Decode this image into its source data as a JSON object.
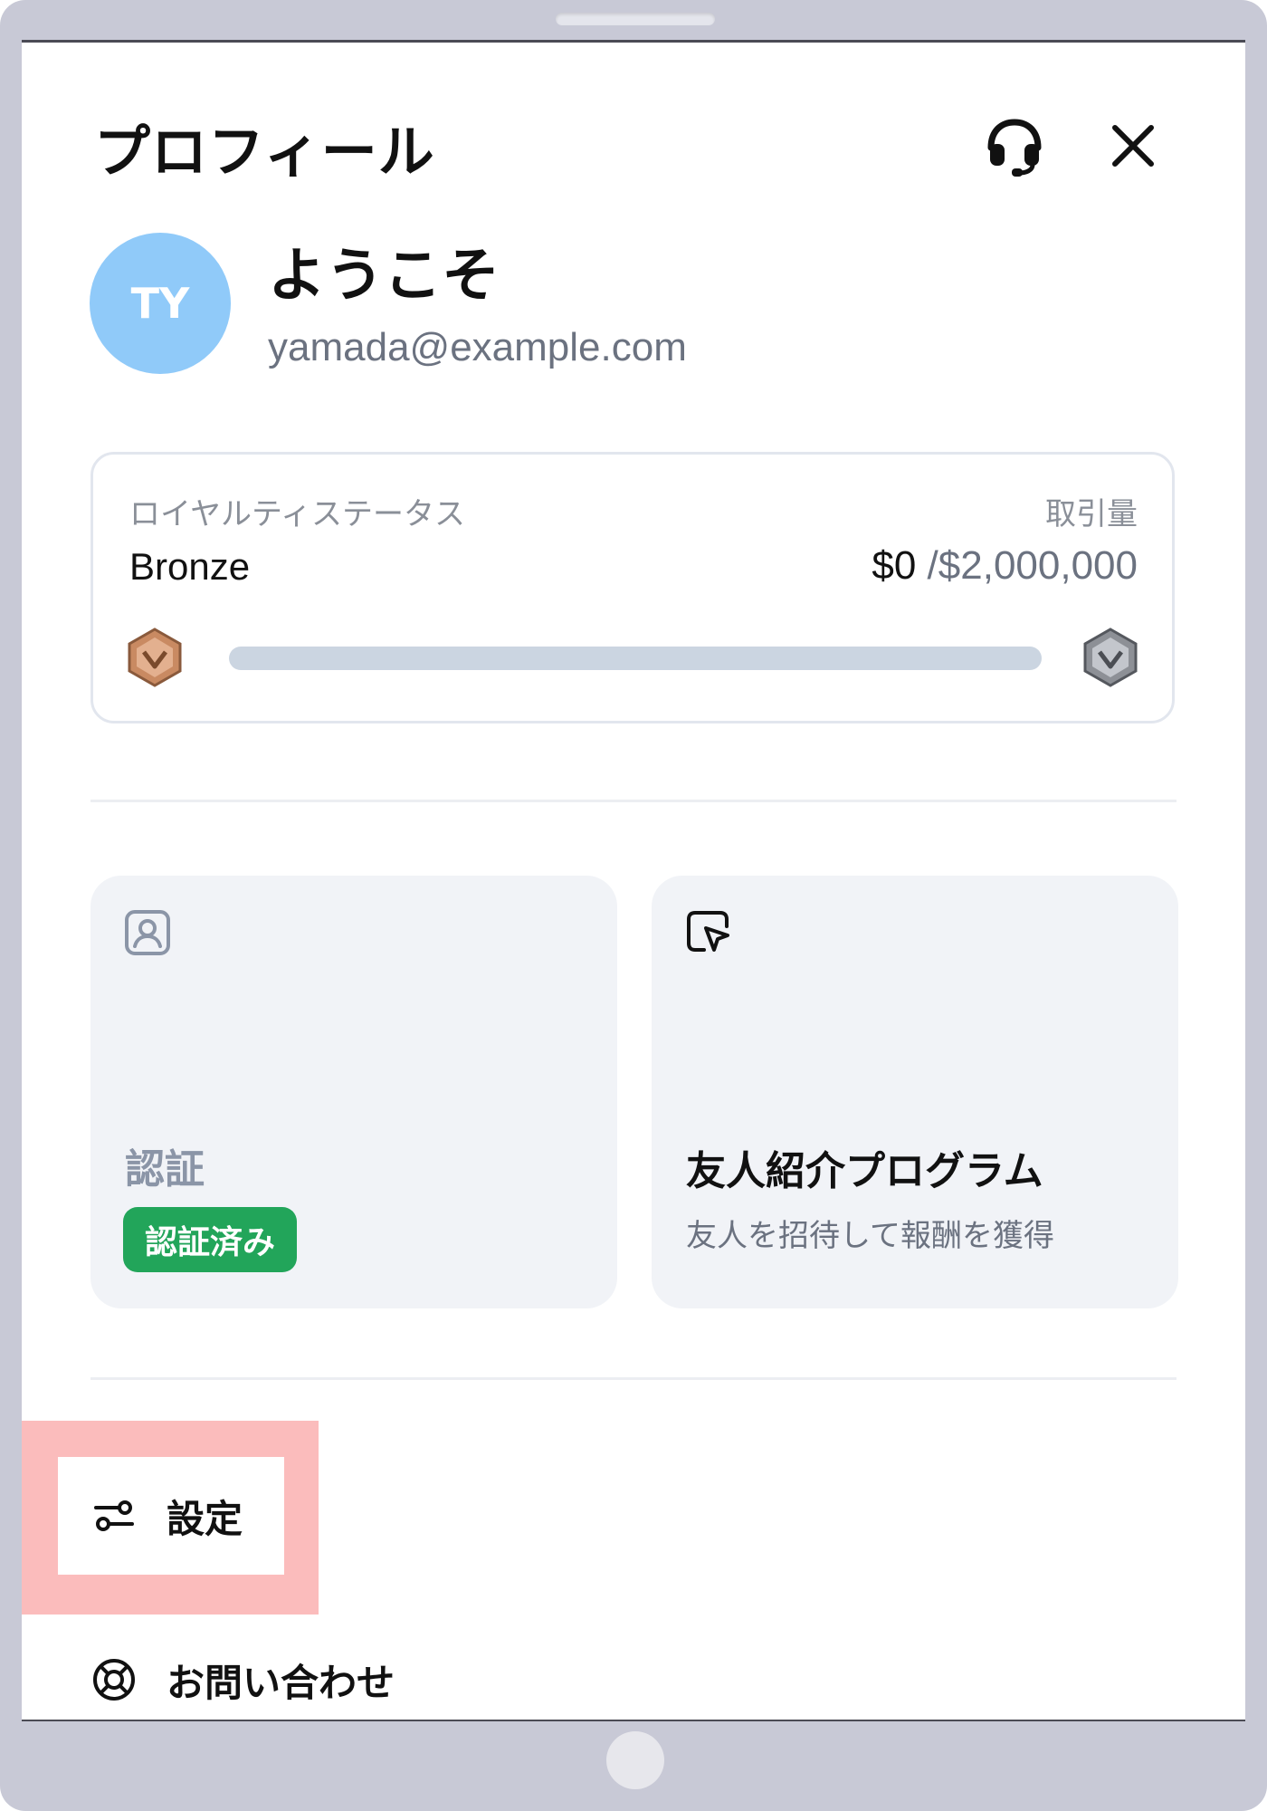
{
  "header": {
    "title": "プロフィール"
  },
  "profile": {
    "initials": "TY",
    "greeting": "ようこそ",
    "email": "yamada@example.com"
  },
  "loyalty": {
    "label": "ロイヤルティステータス",
    "tier": "Bronze",
    "volume_label": "取引量",
    "volume_current": "$0",
    "volume_separator": "/",
    "volume_goal": "$2,000,000",
    "progress_percent": 0,
    "current_badge": "bronze-badge-icon",
    "next_badge": "silver-badge-icon"
  },
  "tiles": {
    "verification": {
      "icon": "id-card-icon",
      "title": "認証",
      "status": "認証済み"
    },
    "referral": {
      "icon": "referral-pointer-icon",
      "title": "友人紹介プログラム",
      "subtitle": "友人を招待して報酬を獲得"
    }
  },
  "menu": {
    "settings": {
      "icon": "sliders-icon",
      "label": "設定"
    },
    "contact": {
      "icon": "lifebuoy-icon",
      "label": "お問い合わせ"
    }
  },
  "colors": {
    "avatar": "#90caf9",
    "verified": "#22a55a",
    "highlight": "#fbbcbc",
    "bronze": "#c98a62",
    "silver": "#8d9096"
  }
}
